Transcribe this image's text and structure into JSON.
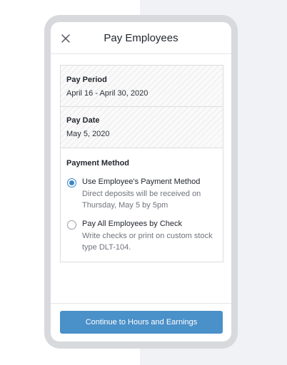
{
  "header": {
    "title": "Pay Employees",
    "close_icon": "close-icon"
  },
  "pay_period": {
    "label": "Pay Period",
    "value": "April 16 - April 30, 2020"
  },
  "pay_date": {
    "label": "Pay Date",
    "value": "May 5, 2020"
  },
  "payment_method": {
    "label": "Payment Method",
    "options": [
      {
        "title": "Use Employee's Payment Method",
        "description": "Direct deposits will be received on Thursday, May 5 by 5pm",
        "selected": true
      },
      {
        "title": "Pay All Employees by Check",
        "description": "Write checks or print on custom stock type DLT-104.",
        "selected": false
      }
    ]
  },
  "footer": {
    "cta_label": "Continue to Hours and Earnings"
  },
  "colors": {
    "accent": "#4a90c9",
    "radio_selected": "#3b86c6"
  }
}
